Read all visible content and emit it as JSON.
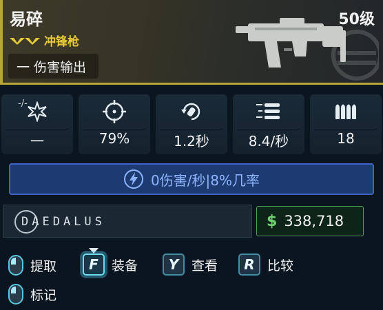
{
  "weapon": {
    "name": "易碎",
    "level": "50级",
    "type": "冲锋枪",
    "role": "一 伤害输出",
    "rarity_color": "#e7c93a"
  },
  "stats": [
    {
      "icon": "burst-icon",
      "label": "-/-",
      "value": "一"
    },
    {
      "icon": "crosshair-icon",
      "label": "",
      "value": "79%"
    },
    {
      "icon": "reload-icon",
      "label": "",
      "value": "1.2秒"
    },
    {
      "icon": "fire-rate-icon",
      "label": "",
      "value": "8.4/秒"
    },
    {
      "icon": "ammo-icon",
      "label": "",
      "value": "18"
    }
  ],
  "perk": {
    "icon": "lightning-icon",
    "text": "0伤害/秒|8%几率",
    "color": "#3c66c4"
  },
  "manufacturer": {
    "name": "DAEDALUS"
  },
  "price": {
    "currency_symbol": "$",
    "value": "338,718"
  },
  "actions": [
    {
      "key": "mouse",
      "label": "提取"
    },
    {
      "key": "F",
      "label": "装备"
    },
    {
      "key": "Y",
      "label": "查看"
    },
    {
      "key": "R",
      "label": "比较"
    },
    {
      "key": "mouse",
      "label": "标记"
    }
  ]
}
